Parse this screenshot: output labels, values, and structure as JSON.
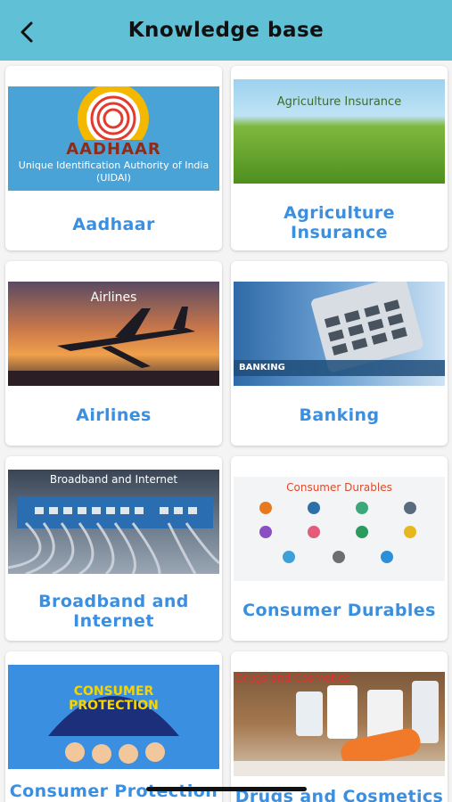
{
  "header": {
    "title": "Knowledge base",
    "back_icon": "chevron-left-icon"
  },
  "colors": {
    "header_bg": "#5fc0d6",
    "label": "#3b8fe0"
  },
  "cards": [
    {
      "label": "Aadhaar",
      "thumb_title": "AADHAAR",
      "thumb_sub": "Unique Identification Authority of India (UIDAI)"
    },
    {
      "label": "Agriculture Insurance",
      "thumb_title": "Agriculture Insurance"
    },
    {
      "label": "Airlines",
      "thumb_title": "Airlines"
    },
    {
      "label": "Banking",
      "thumb_title": "BANKING"
    },
    {
      "label": "Broadband and Internet",
      "thumb_title": "Broadband and Internet"
    },
    {
      "label": "Consumer Durables",
      "thumb_title": "Consumer Durables"
    },
    {
      "label": "Consumer Protection",
      "thumb_title": "CONSUMER PROTECTION"
    },
    {
      "label": "Drugs and Cosmetics",
      "thumb_title": "Drugs and Cosmetics"
    }
  ]
}
